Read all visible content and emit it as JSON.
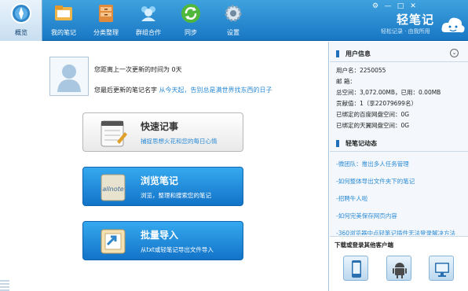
{
  "nav": [
    {
      "label": "概览",
      "icon": "compass-icon"
    },
    {
      "label": "我的笔记",
      "icon": "folder-icon"
    },
    {
      "label": "分类整理",
      "icon": "drawer-icon"
    },
    {
      "label": "群组合作",
      "icon": "group-users-icon"
    },
    {
      "label": "同步",
      "icon": "sync-icon"
    },
    {
      "label": "设置",
      "icon": "gear-icon"
    }
  ],
  "brand": {
    "title": "轻笔记",
    "subtitle": "轻松记录 · 由我所用"
  },
  "window": {
    "settings": "⚙",
    "minimize": "—",
    "maximize": "□",
    "close": "✕"
  },
  "overview": {
    "last_update": "您距离上一次更新的时间为 0天",
    "last_note_prefix": "您最后更新的笔记名字",
    "last_note_name": "从今天起，告别总是满世界找东西的日子"
  },
  "cards": [
    {
      "title": "快速记事",
      "subtitle": "捕捉思想火花和您的每日心情",
      "icon": "notepad-icon"
    },
    {
      "title": "浏览笔记",
      "subtitle": "浏览，整理和搜索您的笔记",
      "icon": "allnote-icon"
    },
    {
      "title": "批量导入",
      "subtitle": "从txt或轻笔记导出文件导入",
      "icon": "import-arrow-icon"
    }
  ],
  "user_info": {
    "heading": "用户信息",
    "lines": [
      "用户名：2250055",
      "邮    箱：",
      "总空间：3,072.00MB，已用：0.00MB",
      "贡献值：1（享22079699名）",
      "已绑定的百度网盘空间：0G",
      "已绑定的天翼网盘空间：0G"
    ]
  },
  "news": {
    "heading": "轻笔记动态",
    "items": [
      "-微团队：推出多人任务管理",
      "-如何整体导出文件夹下的笔记",
      "-招聘牛人啦",
      "-如何完美保存网页内容",
      "-360浏览器中点轻笔记插件无法登录解决方法"
    ]
  },
  "download": {
    "heading": "下载或登录其他客户端",
    "clients": [
      "iphone-icon",
      "android-icon",
      "desktop-monitor-icon"
    ]
  },
  "colors": {
    "header": "#2b8fd5",
    "link": "#2a8ad4",
    "card_blue": "#1f8ce0"
  }
}
